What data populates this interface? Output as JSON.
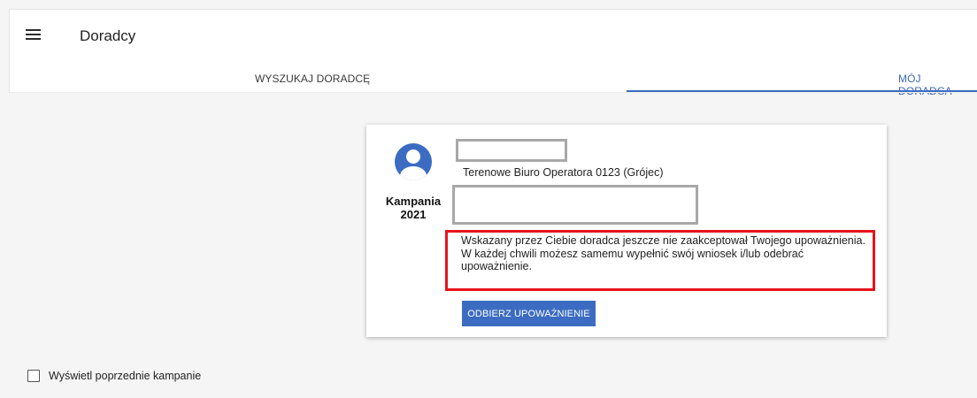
{
  "header": {
    "menu_icon": "hamburger-menu-icon",
    "title": "Doradcy"
  },
  "tabs": [
    {
      "label": "WYSZUKAJ DORADCĘ",
      "active": false
    },
    {
      "label": "MÓJ DORADCA",
      "active": true
    }
  ],
  "card": {
    "avatar_icon": "account-circle-icon",
    "campaign_label": "Kampania 2021",
    "office": "Terenowe Biuro Operatora 0123 (Grójec)",
    "notice": "Wskazany przez Ciebie doradca jeszcze nie zaakceptował Twojego upoważnienia. W każdej chwili możesz samemu wypełnić swój wniosek i/lub odebrać upoważnienie.",
    "revoke_button": "ODBIERZ UPOWAŻNIENIE"
  },
  "previous_campaigns": {
    "label": "Wyświetl poprzednie kampanie",
    "checked": false
  },
  "colors": {
    "accent": "#3b6cc2",
    "highlight_border": "#e5141b",
    "redaction_border": "#a8a8a8"
  }
}
